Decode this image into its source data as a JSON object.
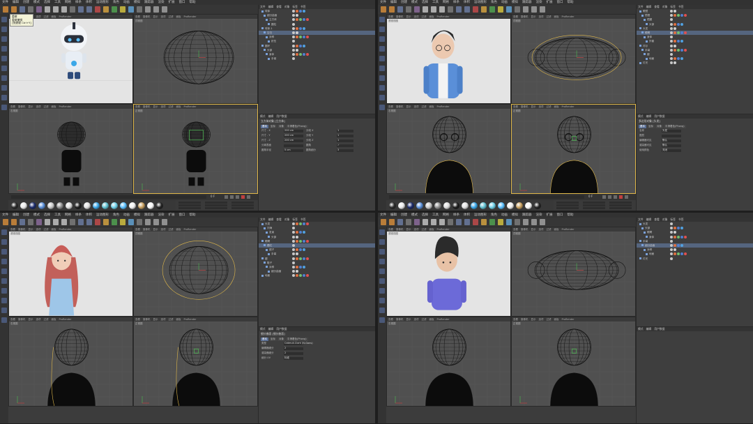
{
  "menu": [
    "文件",
    "编辑",
    "创建",
    "模式",
    "选择",
    "工具",
    "网格",
    "样条",
    "体积",
    "运动图形",
    "角色",
    "动画",
    "模拟",
    "跟踪器",
    "渲染",
    "扩展",
    "窗口",
    "帮助"
  ],
  "viewport_menu": [
    "查看",
    "摄像机",
    "显示",
    "选项",
    "过滤",
    "面板",
    "ProRender"
  ],
  "obj_menu": [
    "文件",
    "编辑",
    "查看",
    "对象",
    "标签",
    "书签"
  ],
  "attr_menu": [
    "模式",
    "编辑",
    "用户数据"
  ],
  "attr_tabs": [
    "基本",
    "坐标",
    "对象",
    "平滑着色(Phong)"
  ],
  "tooltip": {
    "title": "重做",
    "line1": "重做撤销",
    "line2": "[快捷键 Ctrl+Y]"
  },
  "panes": [
    {
      "id": "robot",
      "vp_labels": [
        "透视视图",
        "顶视图",
        "右视图",
        "正视图"
      ],
      "objects": [
        "球体",
        "细分曲面",
        "立方体",
        "圆柱",
        "球体.1",
        "空白",
        "对称",
        "挤压",
        "圆环",
        "头部",
        "身体",
        "手臂"
      ],
      "attr_title": "立方体对象 [立方体]",
      "attr_rows": [
        [
          "尺寸 . X",
          "200 cm",
          "分段 X",
          "1"
        ],
        [
          "尺寸 . Y",
          "200 cm",
          "分段 Y",
          "1"
        ],
        [
          "尺寸 . Z",
          "200 cm",
          "分段 Z",
          "1"
        ],
        [
          "分离表面",
          "",
          "圆角",
          "✓"
        ],
        [
          "圆角半径",
          "5 cm",
          "圆角细分",
          "3"
        ]
      ],
      "frame": "0 F"
    },
    {
      "id": "boy_glasses",
      "vp_labels": [
        "透视视图",
        "顶视图",
        "右视图",
        "正视图"
      ],
      "objects": [
        "眼镜",
        "镜框",
        "镜腿",
        "头部",
        "头发",
        "眼睛",
        "身体",
        "外套",
        "衬衫",
        "手臂",
        "腿",
        "地面",
        "灯光"
      ],
      "attr_title": "多边形对象 [头发]",
      "attr_rows": [
        [
          "名称",
          "头发",
          "",
          ""
        ],
        [
          "图层",
          "",
          "",
          ""
        ],
        [
          "编辑器可见",
          "默认",
          "",
          ""
        ],
        [
          "渲染器可见",
          "默认",
          "",
          ""
        ],
        [
          "使用颜色",
          "关闭",
          "",
          ""
        ]
      ],
      "frame": "0 F"
    },
    {
      "id": "girl",
      "vp_labels": [
        "透视视图",
        "顶视图",
        "右视图",
        "正视图"
      ],
      "objects": [
        "头发",
        "刘海",
        "发束",
        "头部",
        "眼睛",
        "腮红",
        "裙子",
        "手臂",
        "腿",
        "鞋子",
        "对称",
        "细分曲面",
        "地面"
      ],
      "attr_title": "细分曲面 [细分曲面]",
      "attr_rows": [
        [
          "类型",
          "Catmull-Clark (N-Gons)",
          "",
          ""
        ],
        [
          "编辑器细分",
          "2",
          "",
          ""
        ],
        [
          "渲染器细分",
          "2",
          "",
          ""
        ],
        [
          "细分 UV",
          "标准",
          "",
          ""
        ]
      ],
      "frame": "0 F"
    },
    {
      "id": "boy",
      "vp_labels": [
        "透视视图",
        "顶视图",
        "右视图",
        "正视图"
      ],
      "objects": [
        "头发",
        "头部",
        "眼睛",
        "身体",
        "手臂",
        "细分曲面",
        "对称",
        "地面",
        "灯光"
      ],
      "attr_title": "",
      "attr_rows": [],
      "frame": "0 F"
    }
  ],
  "colors": {
    "ui_bg": "#3c3c3c",
    "selection": "#e0b84a",
    "axis_y": "#4caf50",
    "axis_x": "#c04040",
    "accent": "#5a6f95"
  }
}
